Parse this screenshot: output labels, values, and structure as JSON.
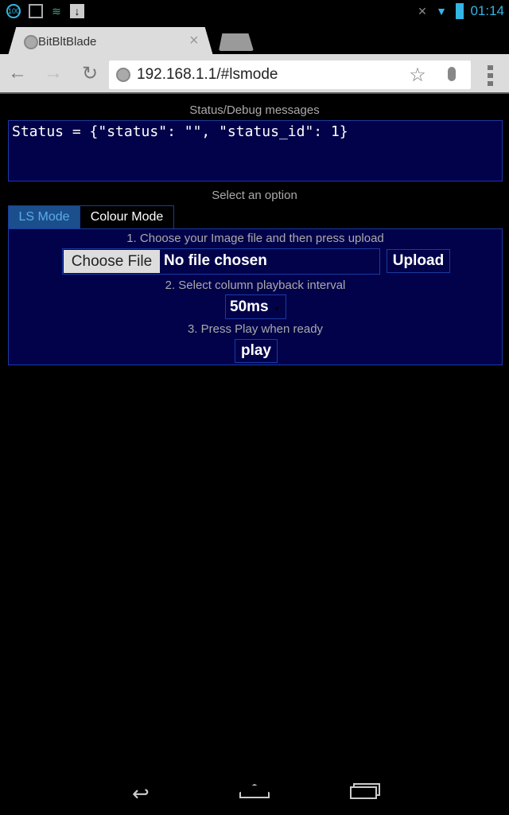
{
  "statusbar": {
    "time": "01:14",
    "notif_count": "100",
    "icons": [
      "notification-count-icon",
      "image-icon",
      "swype-icon",
      "download-icon",
      "mute-icon",
      "wifi-icon",
      "battery-icon"
    ]
  },
  "browser": {
    "tab_title": "BitBltBlade",
    "url": "192.168.1.1/#lsmode"
  },
  "page": {
    "status_heading": "Status/Debug messages",
    "status_text": "Status = {\"status\": \"\", \"status_id\": 1}",
    "options_heading": "Select an option",
    "tabs": [
      {
        "label": "LS Mode",
        "active": true
      },
      {
        "label": "Colour Mode",
        "active": false
      }
    ],
    "step1": "1. Choose your Image file and then press upload",
    "choose_file": "Choose File",
    "no_file": "No file chosen",
    "upload": "Upload",
    "step2": "2. Select column playback interval",
    "interval": "50ms",
    "step3": "3. Press Play when ready",
    "play": "play"
  },
  "colors": {
    "panel_bg": "#02024a",
    "border": "#1a3aa0",
    "active_tab": "#1b4f8c",
    "clock": "#33b5e5"
  }
}
